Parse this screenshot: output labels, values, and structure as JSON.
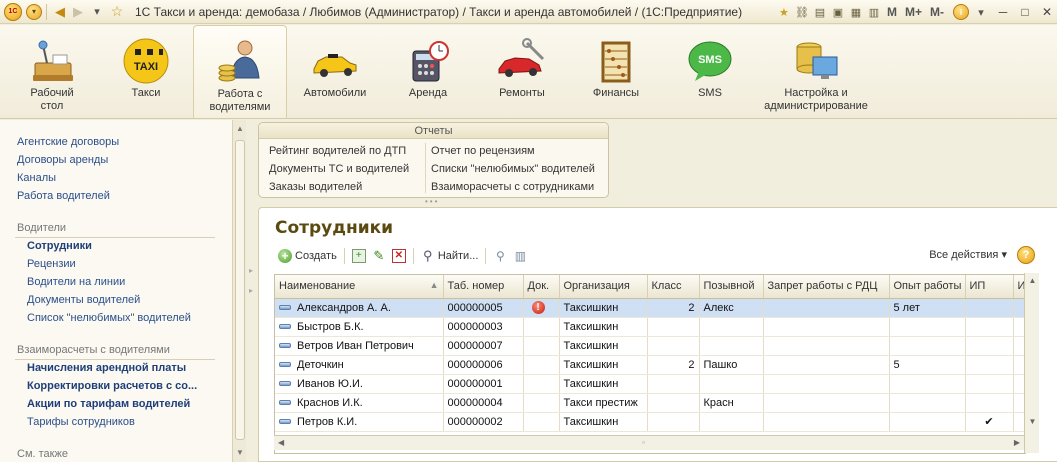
{
  "window": {
    "title": "1С Такси и аренда: демобаза / Любимов (Администратор) / Такси и аренда автомобилей / (1С:Предприятие)",
    "logo_text": "1С",
    "m_labels": [
      "M",
      "M+",
      "M-"
    ]
  },
  "sections": [
    {
      "label": "Рабочий стол",
      "icon": "desktop-icon"
    },
    {
      "label": "Такси",
      "icon": "taxi-icon"
    },
    {
      "label": "Работа с водителями",
      "icon": "driver-icon"
    },
    {
      "label": "Автомобили",
      "icon": "car-icon"
    },
    {
      "label": "Аренда",
      "icon": "calculator-icon"
    },
    {
      "label": "Ремонты",
      "icon": "repair-icon"
    },
    {
      "label": "Финансы",
      "icon": "abacus-icon"
    },
    {
      "label": "SMS",
      "icon": "sms-icon"
    },
    {
      "label": "Настройка и администрирование",
      "icon": "settings-icon"
    }
  ],
  "leftnav": {
    "top_links": [
      "Агентские договоры",
      "Договоры аренды",
      "Каналы",
      "Работа водителей"
    ],
    "group1_title": "Водители",
    "group1_items": [
      "Сотрудники",
      "Рецензии",
      "Водители на линии",
      "Документы водителей",
      "Список \"нелюбимых\" водителей"
    ],
    "group2_title": "Взаиморасчеты с водителями",
    "group2_items": [
      "Начисления арендной платы",
      "Корректировки расчетов с со...",
      "Акции по тарифам водителей",
      "Тарифы сотрудников"
    ],
    "group3_title": "См. также"
  },
  "reports": {
    "title": "Отчеты",
    "left": [
      "Рейтинг водителей по ДТП",
      "Документы ТС и водителей",
      "Заказы водителей"
    ],
    "right": [
      "Отчет по рецензиям",
      "Списки \"нелюбимых\" водителей",
      "Взаиморасчеты с сотрудниками"
    ]
  },
  "form": {
    "title": "Сотрудники",
    "create_label": "Создать",
    "find_label": "Найти...",
    "all_actions_label": "Все действия",
    "help_label": "?"
  },
  "table": {
    "columns": [
      "Наименование",
      "Таб. номер",
      "Док.",
      "Организация",
      "Класс",
      "Позывной",
      "Запрет работы с РДЦ",
      "Опыт работы",
      "ИП",
      "И"
    ],
    "rows": [
      {
        "name": "Александров А. А.",
        "tab": "000000005",
        "doc_error": true,
        "org": "Таксишкин",
        "class": "2",
        "callsign": "Алекс",
        "ban": "",
        "exp": "5 лет",
        "ip": "",
        "selected": true
      },
      {
        "name": "Быстров Б.К.",
        "tab": "000000003",
        "doc_error": false,
        "org": "Таксишкин",
        "class": "",
        "callsign": "",
        "ban": "",
        "exp": "",
        "ip": "",
        "selected": false
      },
      {
        "name": "Ветров Иван Петрович",
        "tab": "000000007",
        "doc_error": false,
        "org": "Таксишкин",
        "class": "",
        "callsign": "",
        "ban": "",
        "exp": "",
        "ip": "",
        "selected": false
      },
      {
        "name": "Деточкин",
        "tab": "000000006",
        "doc_error": false,
        "org": "Таксишкин",
        "class": "2",
        "callsign": "Пашко",
        "ban": "",
        "exp": "5",
        "ip": "",
        "selected": false
      },
      {
        "name": "Иванов Ю.И.",
        "tab": "000000001",
        "doc_error": false,
        "org": "Таксишкин",
        "class": "",
        "callsign": "",
        "ban": "",
        "exp": "",
        "ip": "",
        "selected": false
      },
      {
        "name": "Краснов И.К.",
        "tab": "000000004",
        "doc_error": false,
        "org": "Такси престиж",
        "class": "",
        "callsign": "Красн",
        "ban": "",
        "exp": "",
        "ip": "",
        "selected": false
      },
      {
        "name": "Петров К.И.",
        "tab": "000000002",
        "doc_error": false,
        "org": "Таксишкин",
        "class": "",
        "callsign": "",
        "ban": "",
        "exp": "",
        "ip": "✔",
        "selected": false
      }
    ]
  },
  "colors": {
    "accent": "#e8a217",
    "title_brown": "#5b4a10",
    "link_blue": "#2a4f8c",
    "selection": "#cfe0f5"
  }
}
